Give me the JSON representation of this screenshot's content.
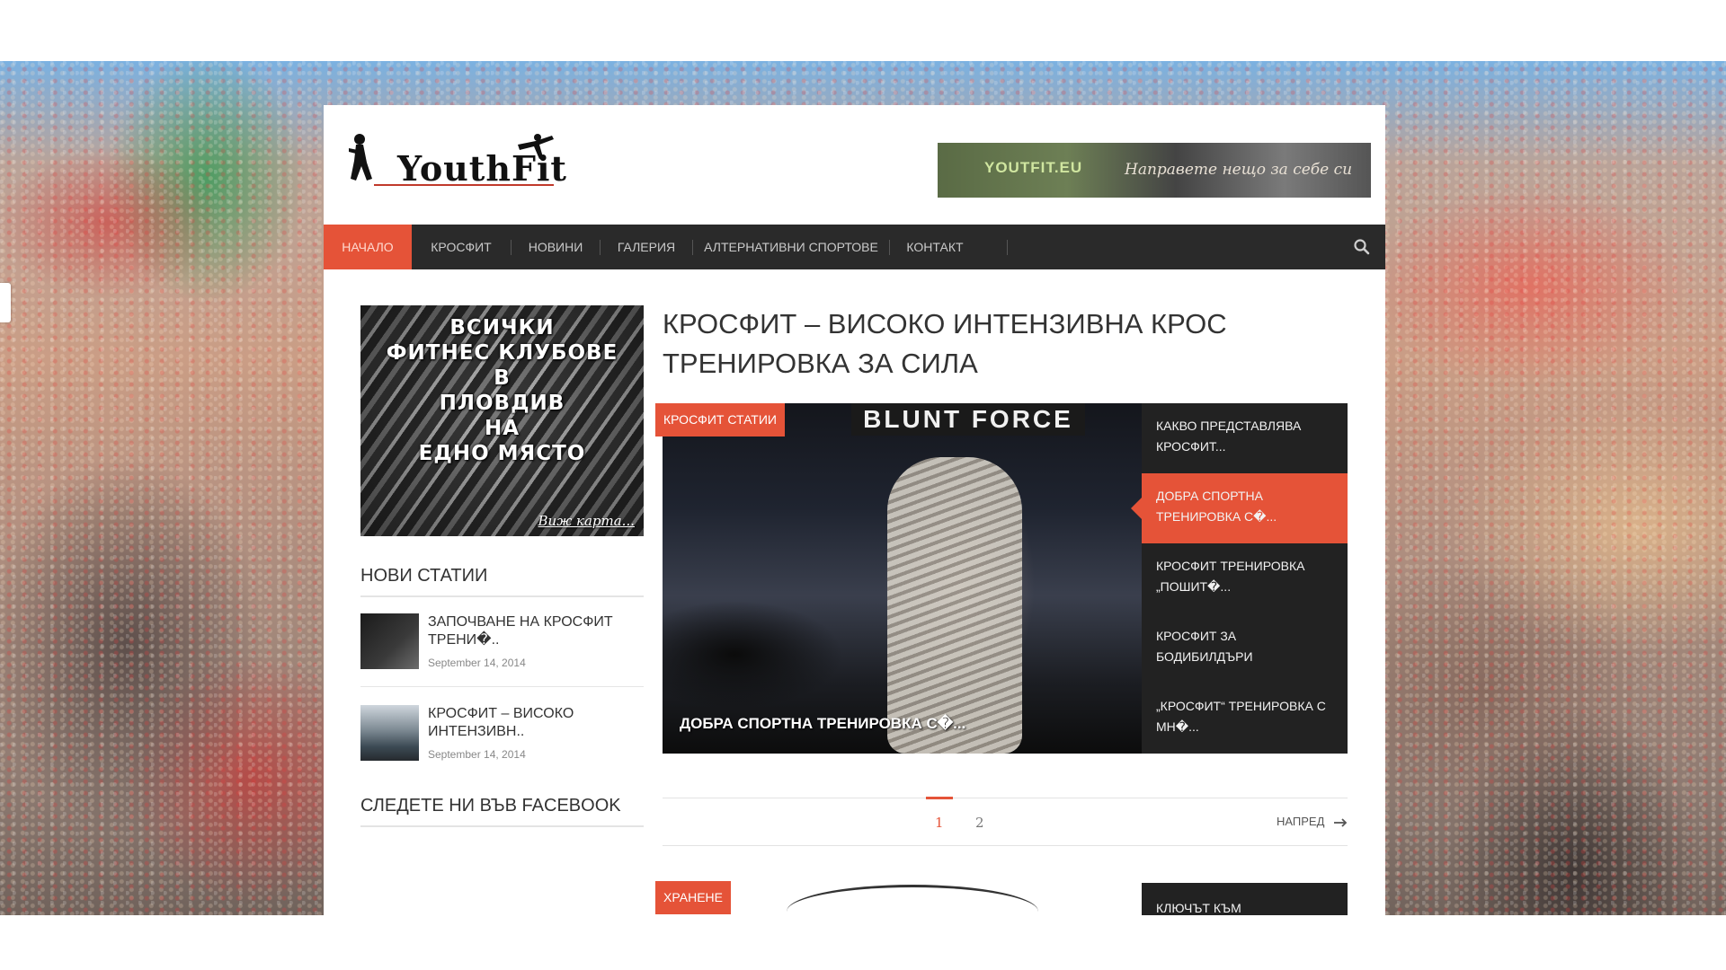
{
  "site": {
    "logo_text": "YouthFit",
    "banner": {
      "brand": "YOUTFIT.EU",
      "slogan": "Направете нещо за себе си"
    }
  },
  "nav": {
    "items": [
      "НАЧАЛО",
      "КРОСФИТ",
      "НОВИНИ",
      "ГАЛЕРИЯ",
      "АЛТЕРНАТИВНИ СПОРТОВЕ",
      "КОНТАКТ"
    ],
    "active_index": 0,
    "search_icon": "search-icon"
  },
  "sidebar": {
    "promo": {
      "lines": [
        "ВСИЧКИ",
        "ФИТНЕС КЛУБОВЕ",
        "В",
        "ПЛОВДИВ",
        "НА",
        "ЕДНО МЯСТО"
      ],
      "link": "Виж карта..."
    },
    "new_posts_heading": "НОВИ СТАТИИ",
    "posts": [
      {
        "title": "ЗАПОЧВАНЕ НА КРОСФИТ ТРЕНИ�..",
        "date": "September 14, 2014"
      },
      {
        "title": "КРОСФИТ – ВИСОКО ИНТЕНЗИВН..",
        "date": "September 14, 2014"
      }
    ],
    "facebook_heading": "СЛЕДЕТЕ НИ ВЪВ FACEBOOK"
  },
  "main": {
    "title": "КРОСФИТ – ВИСОКО ИНТЕНЗИВНА КРОС ТРЕНИРОВКА ЗА СИЛА",
    "slider": {
      "category": "КРОСФИТ СТАТИИ",
      "image_sign": "BLUNT FORCE",
      "caption": "ДОБРА СПОРТНА ТРЕНИРОВКА С�...",
      "items": [
        "КАКВО ПРЕДСТАВЛЯВА КРОСФИТ...",
        "ДОБРА СПОРТНА ТРЕНИРОВКА С�...",
        "КРОСФИТ ТРЕНИРОВКА „ПОШИТ�...",
        "КРОСФИТ ЗА БОДИБИЛДЪРИ",
        "„КРОСФИТ“ ТРЕНИРОВКА С МН�..."
      ],
      "active_index": 1
    },
    "pagination": {
      "pages": [
        "1",
        "2"
      ],
      "active_page": "1",
      "next_label": "НАПРЕД"
    },
    "next_block": {
      "category": "ХРАНЕНЕ",
      "item": "КЛЮЧЪТ КЪМ"
    }
  },
  "colors": {
    "accent": "#e55338",
    "nav_bg": "#2a2a2a",
    "slider_list_bg": "#222222"
  }
}
